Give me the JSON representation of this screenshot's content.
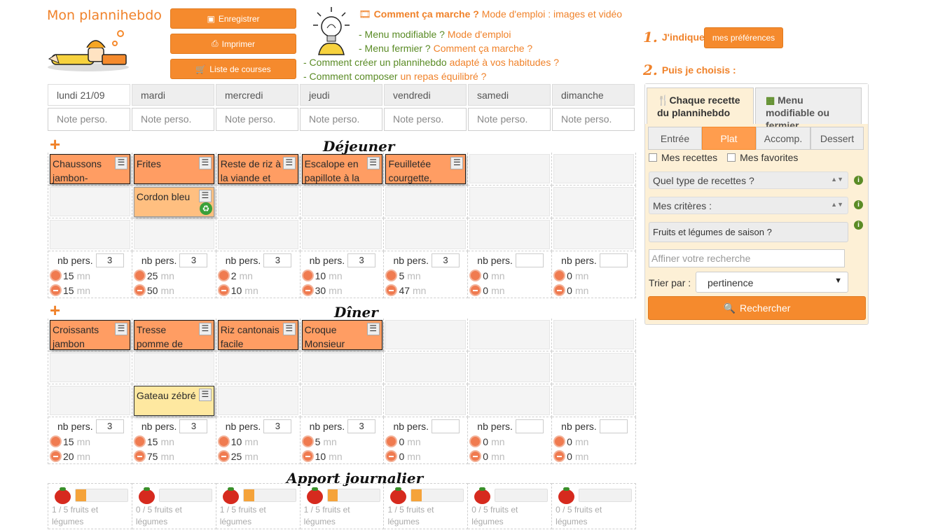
{
  "brand": "Mon plannihebdo",
  "top_buttons": {
    "save": "Enregistrer",
    "print": "Imprimer",
    "shopping": "Liste de courses"
  },
  "howto": {
    "title": "Comment ça marche ?",
    "link": "Mode d'emploi : images et vidéo"
  },
  "links": [
    {
      "text": "- Menu modifiable ?",
      "link": "Mode d'emploi"
    },
    {
      "text": "- Menu fermier ?",
      "link": "Comment ça marche ?"
    },
    {
      "text": "- Comment créer un plannihebdo",
      "link": "adapté à vos habitudes ?"
    },
    {
      "text": "- Comment composer",
      "link": "un repas équilibré ?"
    }
  ],
  "days": [
    "lundi 21/09",
    "mardi",
    "mercredi",
    "jeudi",
    "vendredi",
    "samedi",
    "dimanche"
  ],
  "note_placeholder": "Note perso.",
  "lunch": {
    "title": "Déjeuner",
    "rows": [
      [
        {
          "name": "Chaussons jambon-",
          "style": "main"
        },
        {
          "name": "Frites",
          "style": "main"
        },
        {
          "name": "Reste de riz à la viande et",
          "style": "main"
        },
        {
          "name": "Escalope en papillote à la",
          "style": "main"
        },
        {
          "name": "Feuilletée courgette,",
          "style": "main"
        },
        null,
        null
      ],
      [
        null,
        {
          "name": "Cordon bleu",
          "style": "light",
          "recycle": true
        },
        null,
        null,
        null,
        null,
        null
      ],
      [
        null,
        null,
        null,
        null,
        null,
        null,
        null
      ]
    ],
    "persons": [
      "3",
      "3",
      "3",
      "3",
      "3",
      "",
      ""
    ],
    "prep": [
      "15",
      "25",
      "2",
      "10",
      "5",
      "0",
      "0"
    ],
    "cook": [
      "15",
      "50",
      "10",
      "30",
      "47",
      "0",
      "0"
    ]
  },
  "dinner": {
    "title": "Dîner",
    "rows": [
      [
        {
          "name": "Croissants jambon",
          "style": "main"
        },
        {
          "name": "Tresse pomme de",
          "style": "main"
        },
        {
          "name": "Riz cantonais facile",
          "style": "main"
        },
        {
          "name": "Croque Monsieur",
          "style": "main"
        },
        null,
        null,
        null
      ],
      [
        null,
        null,
        null,
        null,
        null,
        null,
        null
      ],
      [
        null,
        {
          "name": "Gateau zébré",
          "style": "yellow"
        },
        null,
        null,
        null,
        null,
        null
      ]
    ],
    "persons": [
      "3",
      "3",
      "3",
      "3",
      "",
      "",
      ""
    ],
    "prep": [
      "15",
      "15",
      "10",
      "5",
      "0",
      "0",
      "0"
    ],
    "cook": [
      "20",
      "75",
      "25",
      "10",
      "0",
      "0",
      "0"
    ]
  },
  "labels": {
    "nb_pers": "nb pers.",
    "mn": "mn"
  },
  "apport": {
    "title": "Apport journalier",
    "texts": [
      "1 / 5 fruits et légumes",
      "0 / 5 fruits et légumes",
      "1 / 5 fruits et légumes",
      "1 / 5 fruits et légumes",
      "1 / 5 fruits et légumes",
      "0 / 5 fruits et légumes",
      "0 / 5 fruits et légumes"
    ],
    "fractions": [
      0.2,
      0,
      0.2,
      0.2,
      0.2,
      0,
      0
    ]
  },
  "sidebar": {
    "step1_num": "1.",
    "step1": "J'indique",
    "pref_button": "mes préférences",
    "step2_num": "2.",
    "step2": "Puis je choisis :",
    "tab1": "Chaque recette du plannihebdo",
    "tab2": "Menu modifiable ou fermier",
    "categories": [
      "Entrée",
      "Plat",
      "Accomp.",
      "Dessert"
    ],
    "active_category": "Plat",
    "check1": "Mes recettes",
    "check2": "Mes favorites",
    "type_select": "Quel type de recettes ?",
    "criteria_select": "Mes critères :",
    "season_button": "Fruits et légumes de saison ?",
    "search_placeholder": "Affiner votre recherche",
    "sort_label": "Trier par :",
    "sort_value": "pertinence",
    "search_button": "Rechercher"
  },
  "colors": {
    "accent": "#f58a2d",
    "recipe": "#ff9d63",
    "green": "#5a8b25"
  }
}
